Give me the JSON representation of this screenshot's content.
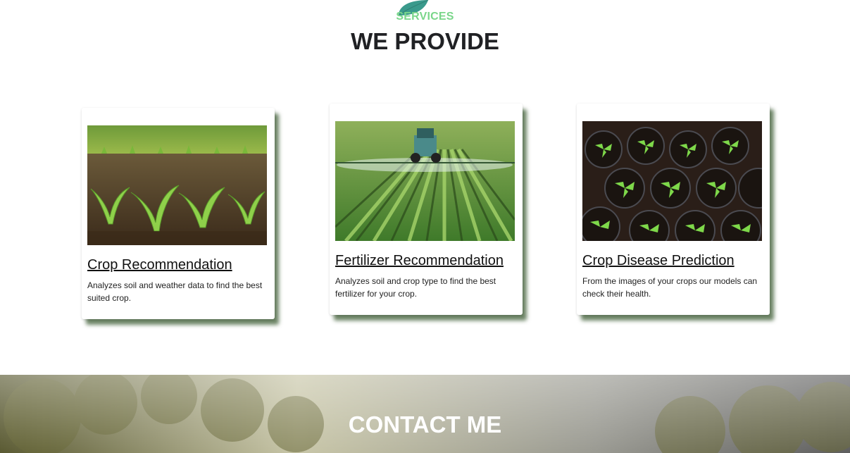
{
  "services": {
    "kicker": "SERVICES",
    "heading": "WE PROVIDE",
    "cards": [
      {
        "title": "Crop Recommendation",
        "description": "Analyzes soil and weather data to find the best suited crop."
      },
      {
        "title": "Fertilizer Recommendation",
        "description": "Analyzes soil and crop type to find the best fertilizer for your crop."
      },
      {
        "title": "Crop Disease Prediction",
        "description": "From the images of your crops our models can check their health."
      }
    ]
  },
  "contact": {
    "title": "CONTACT ME"
  },
  "colors": {
    "accent_green": "#7ad68a",
    "leaf_teal": "#3a9a8c",
    "shadow_green": "#2d5023"
  }
}
